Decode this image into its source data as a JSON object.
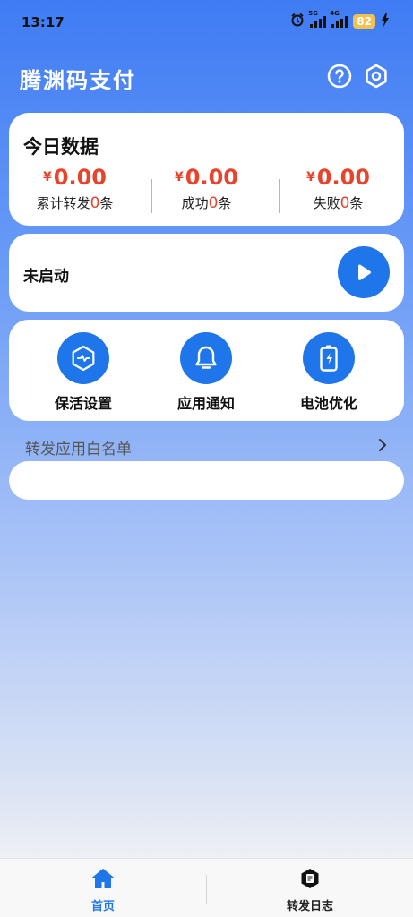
{
  "status_bar": {
    "time": "13:17",
    "net1": "5G",
    "net2": "4G",
    "battery": "82"
  },
  "header": {
    "title": "腾渊码支付",
    "help_icon": "question-circle-icon",
    "settings_icon": "hexagon-gear-icon"
  },
  "today": {
    "title": "今日数据",
    "currency": "¥",
    "stats": [
      {
        "amount": "0.00",
        "label_pre": "累计转发",
        "count": "0",
        "label_post": "条"
      },
      {
        "amount": "0.00",
        "label_pre": "成功",
        "count": "0",
        "label_post": "条"
      },
      {
        "amount": "0.00",
        "label_pre": "失败",
        "count": "0",
        "label_post": "条"
      }
    ]
  },
  "service": {
    "status": "未启动",
    "play_icon": "play-icon"
  },
  "tools": [
    {
      "label": "保活设置",
      "icon": "heartbeat-hexagon-icon"
    },
    {
      "label": "应用通知",
      "icon": "bell-icon"
    },
    {
      "label": "电池优化",
      "icon": "battery-icon"
    }
  ],
  "whitelist": {
    "label": "转发应用白名单",
    "chevron": "›"
  },
  "tabbar": {
    "tabs": [
      {
        "label": "首页",
        "active": true
      },
      {
        "label": "转发日志",
        "active": false
      }
    ]
  },
  "colors": {
    "accent": "#1f76ea",
    "amount": "#e8442b"
  }
}
